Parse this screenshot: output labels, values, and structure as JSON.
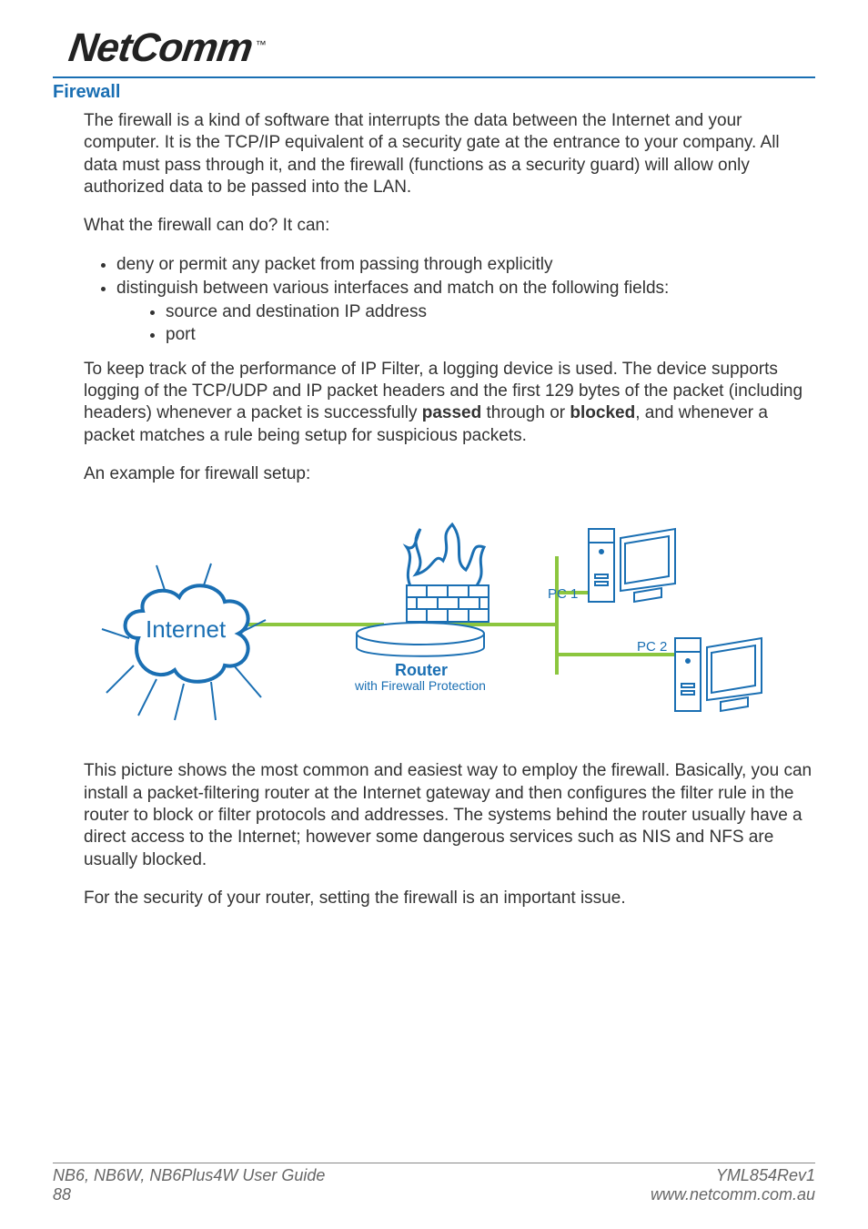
{
  "brand": {
    "name": "NetComm",
    "tm": "™"
  },
  "section": {
    "title": "Firewall"
  },
  "para": {
    "intro": "The firewall is a kind of software that interrupts the data between the Internet and your computer. It is the TCP/IP equivalent of a security gate at the entrance to your company. All data must pass through it, and the firewall (functions as a security guard) will allow only authorized data to be passed into the LAN.",
    "whatcan": "What the firewall can do? It can:",
    "bullets": {
      "b1": "deny or permit any packet from passing through explicitly",
      "b2": "distinguish between various interfaces and match on the following fields:",
      "b2a": "source and destination IP address",
      "b2b": "port"
    },
    "log_pre": "To keep track of the performance of IP Filter, a logging device is used. The device supports logging of the TCP/UDP and IP packet headers and the first 129 bytes of the packet (including headers) whenever a packet is successfully ",
    "log_passed": "passed",
    "log_mid": " through or ",
    "log_blocked": "blocked",
    "log_post": ", and whenever a packet matches a rule being setup for suspicious packets.",
    "example": "An example for firewall setup:",
    "picture": "This picture shows the most common and easiest way to employ the firewall. Basically, you can install a packet-filtering router at the Internet gateway and then configures the filter rule in the router to block or filter protocols and addresses. The systems behind the router usually have a direct access to the Internet; however some dangerous services such as NIS and NFS are usually blocked.",
    "security": "For the security of your router, setting the firewall is an important issue."
  },
  "diagram": {
    "internet": "Internet",
    "router": "Router",
    "router_sub": "with Firewall Protection",
    "pc1": "PC 1",
    "pc2": "PC 2"
  },
  "footer": {
    "left1": "NB6, NB6W, NB6Plus4W User Guide",
    "left2": "88",
    "right1": "YML854Rev1",
    "right2": "www.netcomm.com.au"
  }
}
